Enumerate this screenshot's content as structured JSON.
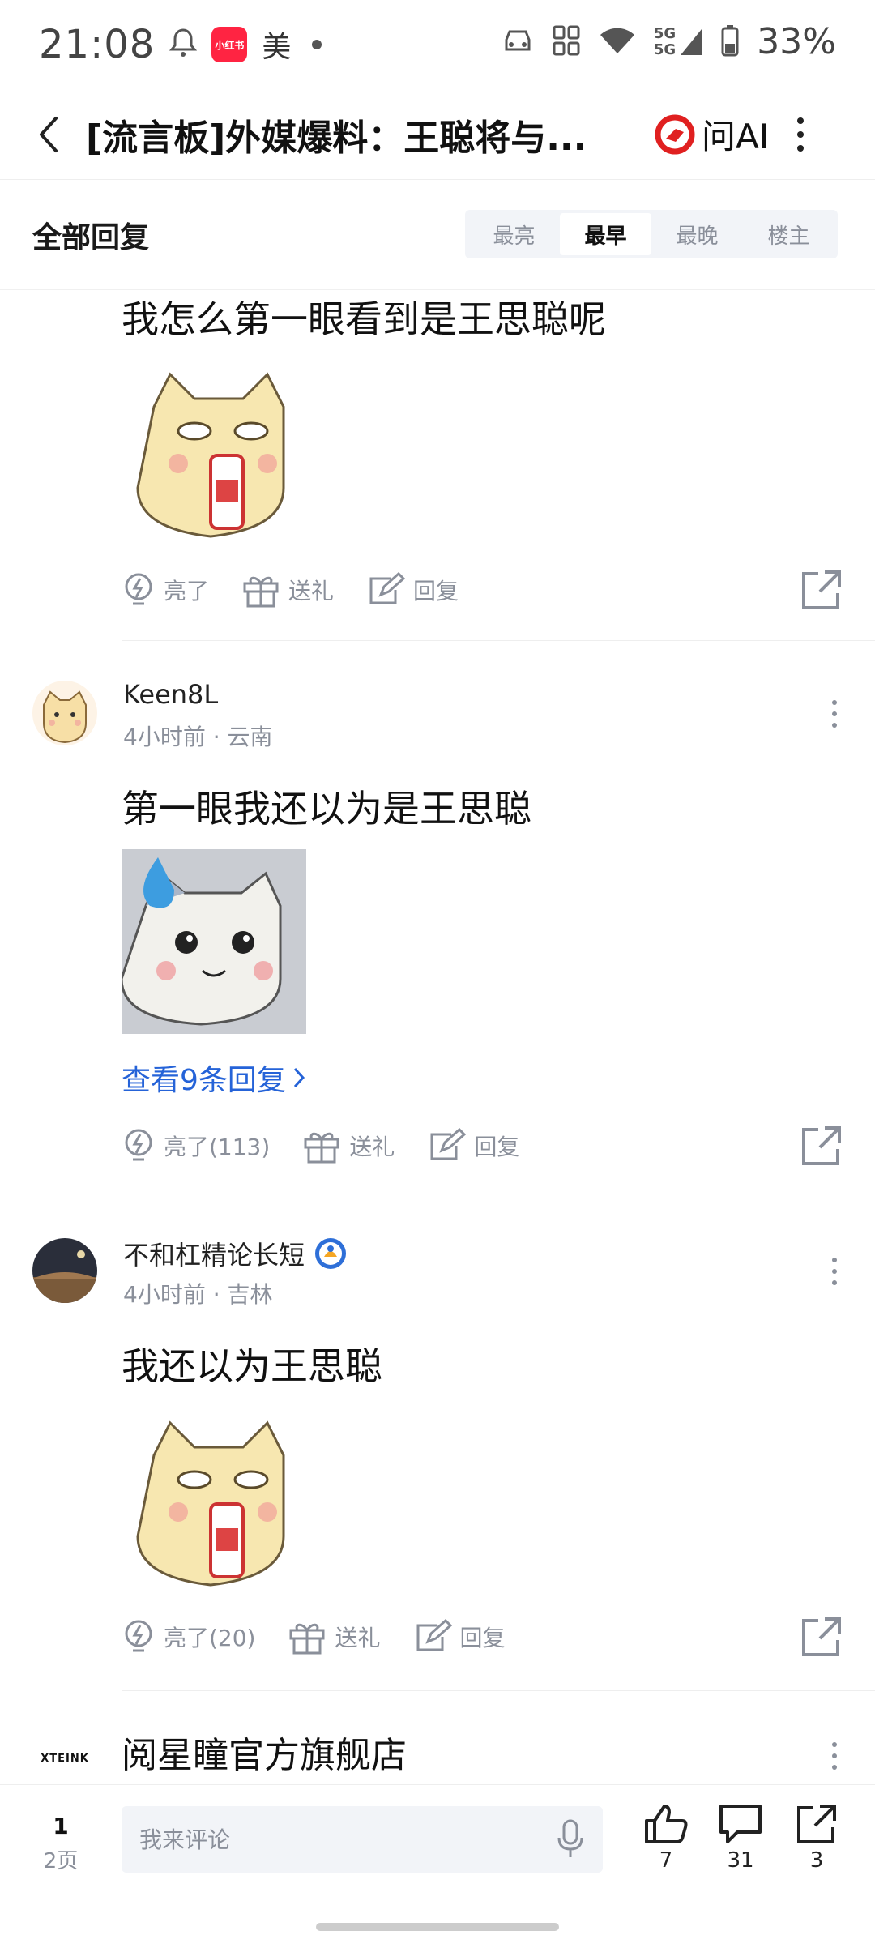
{
  "status_bar": {
    "time": "21:08",
    "app_badge": "小红书",
    "carrier_char": "美",
    "network_label_top": "5G",
    "network_label_bottom": "5G",
    "battery": "33%"
  },
  "header": {
    "title": "[流言板]外媒爆料：王聪将与...",
    "ask_ai_label": "问AI"
  },
  "sort_bar": {
    "title": "全部回复",
    "tabs": [
      "最亮",
      "最早",
      "最晚",
      "楼主"
    ],
    "active_tab": "最早"
  },
  "comments": [
    {
      "text": "我怎么第一眼看到是王思聪呢",
      "sticker": "cat-bottle-sticker",
      "actions": {
        "light": "亮了",
        "gift": "送礼",
        "reply": "回复"
      }
    },
    {
      "username": "Keen8L",
      "meta": "4小时前 · 云南",
      "text": "第一眼我还以为是王思聪",
      "sticker": "sweat-cat-sticker",
      "view_replies": "查看9条回复",
      "actions": {
        "light": "亮了(113)",
        "gift": "送礼",
        "reply": "回复"
      }
    },
    {
      "username": "不和杠精论长短",
      "meta": "4小时前 · 吉林",
      "text": "我还以为王思聪",
      "sticker": "cat-bottle-sticker",
      "actions": {
        "light": "亮了(20)",
        "gift": "送礼",
        "reply": "回复"
      }
    },
    {
      "username": "阅星瞳官方旗舰店",
      "avatar_text": "XTEINK"
    }
  ],
  "bottom_bar": {
    "page_current": "1",
    "page_total": "2页",
    "comment_placeholder": "我来评论",
    "likes": "7",
    "comments": "31",
    "shares": "3"
  }
}
